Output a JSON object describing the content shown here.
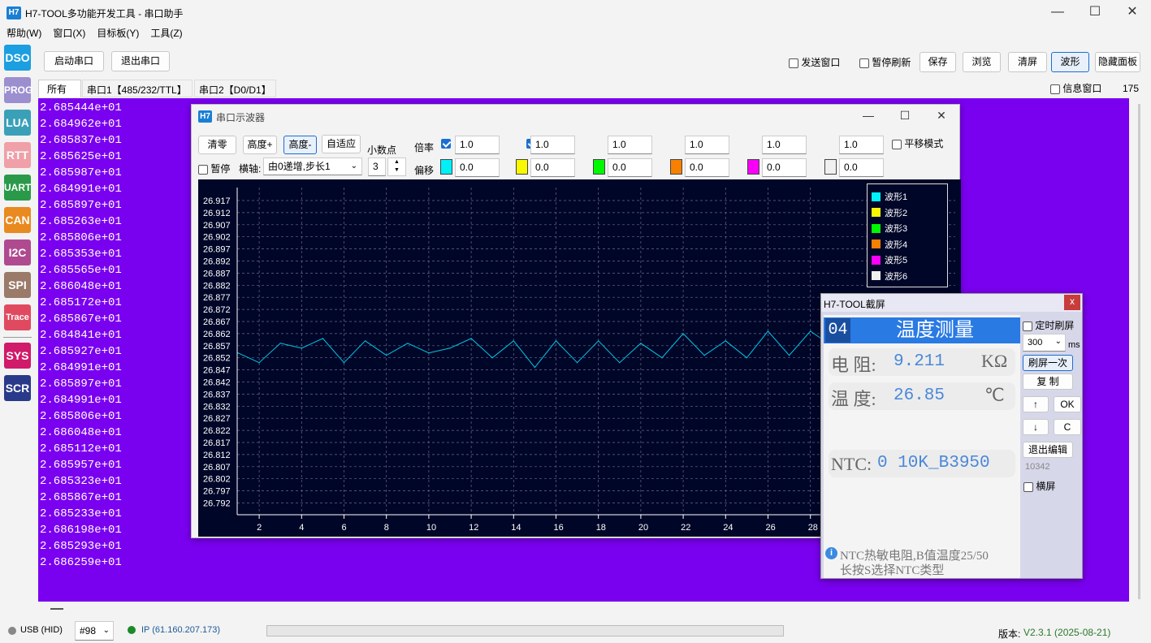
{
  "window": {
    "logo": "H7",
    "title": "H7-TOOL多功能开发工具 - 串口助手",
    "min": "—",
    "max": "☐",
    "close": "✕"
  },
  "menu": [
    "帮助(W)",
    "窗口(X)",
    "目标板(Y)",
    "工具(Z)"
  ],
  "sidebar": [
    {
      "label": "DSO",
      "color": "#1b9fe0"
    },
    {
      "label": "PROG",
      "color": "#9b8fd0"
    },
    {
      "label": "LUA",
      "color": "#3aa0b8"
    },
    {
      "label": "RTT",
      "color": "#f0a0a8"
    },
    {
      "label": "UART",
      "color": "#2a9a4a"
    },
    {
      "label": "CAN",
      "color": "#e88a20"
    },
    {
      "label": "I2C",
      "color": "#b04a90"
    },
    {
      "label": "SPI",
      "color": "#9a7a68"
    },
    {
      "label": "Trace",
      "color": "#e04a60"
    },
    {
      "label": "SYS",
      "color": "#d01a6a"
    },
    {
      "label": "SCR",
      "color": "#2a3a8a"
    }
  ],
  "toolbar": {
    "start": "启动串口",
    "exit": "退出串口",
    "send_window": "发送窗口",
    "pause_refresh": "暂停刷新",
    "save": "保存",
    "browse": "浏览",
    "clear": "清屏",
    "wave": "波形",
    "hide_panel": "隐藏面板"
  },
  "tabs": [
    "所有",
    "串口1【485/232/TTL】",
    "串口2【D0/D1】"
  ],
  "info_window": "信息窗口",
  "line_count": "175",
  "serial_lines": [
    "2.685444e+01",
    "2.684962e+01",
    "2.685837e+01",
    "2.685625e+01",
    "2.685987e+01",
    "2.684991e+01",
    "2.685897e+01",
    "2.685263e+01",
    "2.685806e+01",
    "2.685353e+01",
    "2.685565e+01",
    "2.686048e+01",
    "2.685172e+01",
    "2.685867e+01",
    "2.684841e+01",
    "2.685927e+01",
    "2.684991e+01",
    "2.685897e+01",
    "2.684991e+01",
    "2.685806e+01",
    "2.686048e+01",
    "2.685112e+01",
    "2.685957e+01",
    "2.685323e+01",
    "2.685867e+01",
    "2.685233e+01",
    "2.686198e+01",
    "2.685293e+01",
    "2.686259e+01"
  ],
  "scope": {
    "title": "串口示波器",
    "clear": "清零",
    "height_plus": "高度+",
    "height_minus": "高度-",
    "auto": "自适应",
    "decimals_label": "小数点",
    "decimals_value": "3",
    "pause": "暂停",
    "axis_label": "横轴:",
    "axis_value": "由0递增,步长1",
    "scale_label": "倍率",
    "offset_label": "偏移",
    "pan_mode": "平移模式",
    "channels": [
      {
        "color": "#00f0f8",
        "scale": "1.0",
        "offset": "0.0"
      },
      {
        "color": "#f8f800",
        "scale": "1.0",
        "offset": "0.0"
      },
      {
        "color": "#00f800",
        "scale": "1.0",
        "offset": "0.0"
      },
      {
        "color": "#f88000",
        "scale": "1.0",
        "offset": "0.0"
      },
      {
        "color": "#f800f8",
        "scale": "1.0",
        "offset": "0.0"
      },
      {
        "color": "#f0f0f0",
        "scale": "1.0",
        "offset": "0.0"
      }
    ],
    "legend": [
      "波形1",
      "波形2",
      "波形3",
      "波形4",
      "波形5",
      "波形6"
    ]
  },
  "chart_data": {
    "type": "line",
    "y_ticks": [
      "26.917",
      "26.912",
      "26.907",
      "26.902",
      "26.897",
      "26.892",
      "26.887",
      "26.882",
      "26.877",
      "26.872",
      "26.867",
      "26.862",
      "26.857",
      "26.852",
      "26.847",
      "26.842",
      "26.837",
      "26.832",
      "26.827",
      "26.822",
      "26.817",
      "26.812",
      "26.807",
      "26.802",
      "26.797",
      "26.792"
    ],
    "x_ticks": [
      "2",
      "4",
      "6",
      "8",
      "10",
      "12",
      "14",
      "16",
      "18",
      "20",
      "22",
      "24",
      "26",
      "28"
    ],
    "ylim": [
      26.79,
      26.919
    ],
    "xlim": [
      1,
      28.8
    ],
    "grid": true,
    "series": [
      {
        "name": "波形1",
        "color": "#00c8e8",
        "x": [
          1,
          2,
          3,
          4,
          5,
          6,
          7,
          8,
          9,
          10,
          11,
          12,
          13,
          14,
          15,
          16,
          17,
          18,
          19,
          20,
          21,
          22,
          23,
          24,
          25,
          26,
          27,
          28,
          29
        ],
        "values": [
          26.854,
          26.85,
          26.858,
          26.856,
          26.86,
          26.85,
          26.859,
          26.853,
          26.858,
          26.854,
          26.856,
          26.86,
          26.852,
          26.859,
          26.848,
          26.859,
          26.85,
          26.859,
          26.85,
          26.858,
          26.852,
          26.862,
          26.853,
          26.859,
          26.852,
          26.863,
          26.853,
          26.863,
          26.857
        ]
      }
    ]
  },
  "capture": {
    "title": "H7-TOOL截屏",
    "close": "x",
    "page_no": "04",
    "page_title": "温度测量",
    "resistance_label": "电 阻:",
    "resistance_value": "9.211",
    "resistance_unit": "KΩ",
    "temp_label": "温 度:",
    "temp_value": "26.85",
    "temp_unit": "℃",
    "ntc_label": "NTC:",
    "ntc_value": "0 10K_B3950",
    "tip_line1": "NTC热敏电阻,B值温度25/50",
    "tip_line2": "长按S选择NTC类型",
    "timed_refresh": "定时刷屏",
    "interval": "300",
    "ms": "ms",
    "refresh_once": "刷屏一次",
    "copy": "复 制",
    "up": "↑",
    "ok": "OK",
    "down": "↓",
    "c": "C",
    "exit_edit": "退出编辑",
    "counter": "10342",
    "landscape": "横屏"
  },
  "status": {
    "usb": "USB (HID)",
    "device": "#98",
    "ip": "IP (61.160.207.173)",
    "version_label": "版本:",
    "version": "V2.3.1 (2025-08-21)"
  }
}
